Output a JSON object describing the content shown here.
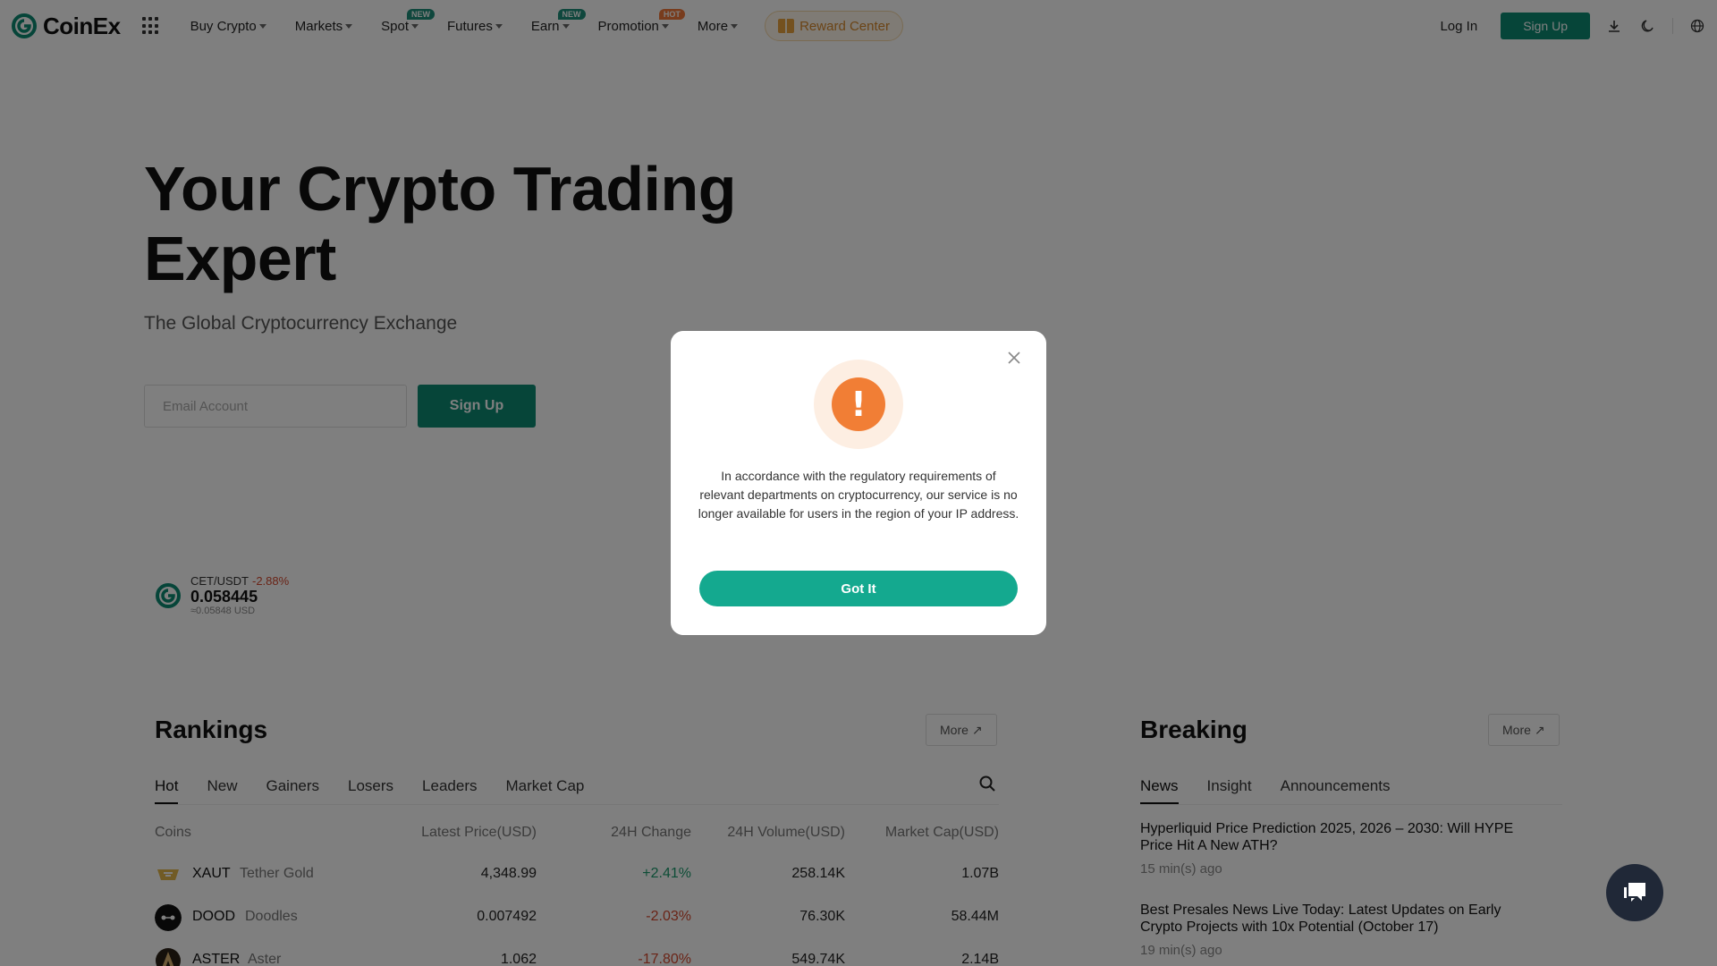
{
  "header": {
    "logo_text": "CoinEx",
    "nav": [
      {
        "label": "Buy Crypto",
        "badge": ""
      },
      {
        "label": "Markets",
        "badge": ""
      },
      {
        "label": "Spot",
        "badge": "NEW"
      },
      {
        "label": "Futures",
        "badge": ""
      },
      {
        "label": "Earn",
        "badge": "NEW"
      },
      {
        "label": "Promotion",
        "badge": "HOT"
      },
      {
        "label": "More",
        "badge": ""
      }
    ],
    "reward_center": "Reward Center",
    "login": "Log In",
    "signup": "Sign Up",
    "icons": [
      "download-icon",
      "moon-icon",
      "globe-icon"
    ]
  },
  "hero": {
    "title_line1": "Your Crypto Trading",
    "title_line2": "Expert",
    "subtitle": "The Global Cryptocurrency Exchange",
    "email_placeholder": "Email Account",
    "signup_button": "Sign Up"
  },
  "ticker": {
    "pair": "CET/USDT",
    "change": "-2.88%",
    "price": "0.058445",
    "usd": "≈0.05848 USD"
  },
  "rankings": {
    "title": "Rankings",
    "more": "More",
    "tabs": [
      "Hot",
      "New",
      "Gainers",
      "Losers",
      "Leaders",
      "Market Cap"
    ],
    "columns": [
      "Coins",
      "Latest Price(USD)",
      "24H Change",
      "24H Volume(USD)",
      "Market Cap(USD)"
    ],
    "rows": [
      {
        "symbol": "XAUT",
        "name": "Tether Gold",
        "price": "4,348.99",
        "change": "+2.41%",
        "volume": "258.14K",
        "cap": "1.07B",
        "color": "#e2b64a"
      },
      {
        "symbol": "DOOD",
        "name": "Doodles",
        "price": "0.007492",
        "change": "-2.03%",
        "volume": "76.30K",
        "cap": "58.44M",
        "color": "#111111"
      },
      {
        "symbol": "ASTER",
        "name": "Aster",
        "price": "1.062",
        "change": "-17.80%",
        "volume": "549.74K",
        "cap": "2.14B",
        "color": "#8a6a3a"
      }
    ]
  },
  "breaking": {
    "title": "Breaking",
    "more": "More",
    "tabs": [
      "News",
      "Insight",
      "Announcements"
    ],
    "items": [
      {
        "headline": "Hyperliquid Price Prediction 2025, 2026 – 2030: Will HYPE Price Hit A New ATH?",
        "time": "15 min(s) ago"
      },
      {
        "headline": "Best Presales News Live Today: Latest Updates on Early Crypto Projects with 10x Potential (October 17)",
        "time": "19 min(s) ago"
      }
    ]
  },
  "modal": {
    "message": "In accordance with the regulatory requirements of relevant departments on cryptocurrency, our service is no longer available for users in the region of your IP address.",
    "button": "Got It",
    "icon": "warning-icon"
  },
  "colors": {
    "brand": "#0d8a73",
    "modal_button": "#14a98f",
    "warning": "#f17e35",
    "positive": "#1a9a6d",
    "negative": "#d5492e"
  }
}
